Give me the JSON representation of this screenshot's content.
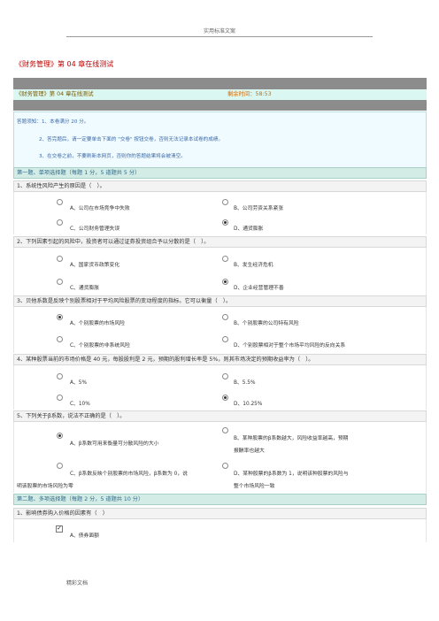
{
  "page_header": "实用标准文案",
  "doc_title": "《财务管理》第 04 章在线测试",
  "test_bar": {
    "title": "《财务管理》第 04 章在线测试",
    "timer": "剩余时间：58:53"
  },
  "notice": [
    "答题须知：1、本卷满分 20 分。",
    "2、答完题后，请一定要单击下面的 \"交卷\" 按钮交卷，否则无法记录本试卷的成绩。",
    "3、在交卷之前，不要刷新本网页，否则你的答题结果将会被清空。"
  ],
  "section1": "第一题、单项选择题（每题 1 分，5 道题共 5 分）",
  "questions": [
    {
      "q": "1、系统性风险产生的原因是（　）。",
      "a": "A、公司在市场竞争中失败",
      "b": "B、公司劳资关系紧张",
      "c": "C、公司财务管理失误",
      "d": "D、通货膨胀",
      "selected": "D"
    },
    {
      "q": "2、下列因素引起的风险中，投资者可以通过证券投资组合予以分散的是（　）。",
      "a": "A、国家货币政策变化",
      "b": "B、发生经济危机",
      "c": "C、通货膨胀",
      "d": "D、企业经营管理不善",
      "selected": "D"
    },
    {
      "q": "3、贝他系数是反映个别股票相对于平均风险股票的变动程度的指标。它可以衡量（　）。",
      "a": "A、个别股票的市场风险",
      "b": "B、个别股票的公司特有风险",
      "c": "C、个别股票的非系统风险",
      "d": "D、个别股票相对于整个市场平均风险的反向关系",
      "selected": "A"
    },
    {
      "q": "4、某种股票当前的市场价格是 40 元，每股股利是 2 元，预期的股利增长率是 5%，则其市场决定的预期收益率为（　）。",
      "a": "A、5%",
      "b": "B、5.5%",
      "c": "C、10%",
      "d": "D、10.25%",
      "selected": "D"
    },
    {
      "q": "5、下列关于β系数，说法不正确的是（　）。",
      "a": "A、β系数可用来衡量可分散风险的大小",
      "b1": "B、某种股票的β系数越大，风险收益率越高，预期",
      "b2": "报酬率也越大",
      "c1": "C、β系数反映个别股票的市场风险，β系数为 0，说",
      "c2": "明该股票的市场风险为零",
      "d1": "D、某种股票的β系数为 1，说明该种股票的风险与",
      "d2": "整个市场风险一致",
      "selected": "A"
    }
  ],
  "section2": "第二题、多项选择题（每题 2 分，5 道题共 10 分）",
  "mq1": {
    "q": "1、影响债券购入价格的因素有（　）",
    "a": "A、债券面额",
    "checked": true
  },
  "page_footer": "精彩文档"
}
